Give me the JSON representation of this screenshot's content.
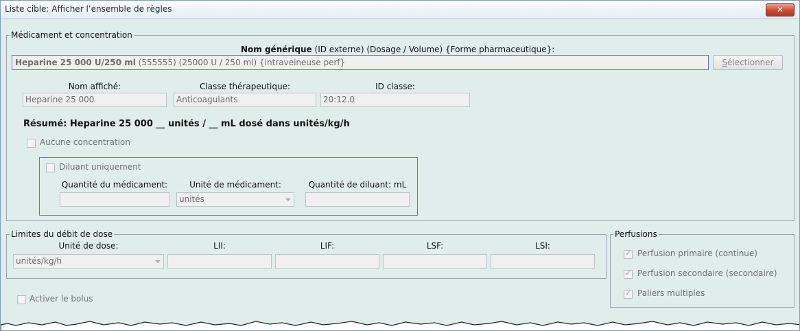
{
  "window": {
    "title": "Liste cible: Afficher l’ensemble de règles",
    "close_symbol": "✕"
  },
  "med": {
    "legend": "Médicament et concentration",
    "header_bold": "Nom générique",
    "header_rest": "(ID externe) (Dosage / Volume) {Forme pharmaceutique}:",
    "name_bold": "Heparine 25 000 U/250 ml",
    "name_rest": "(555555) (25000 U / 250 ml) {intraveineuse perf}",
    "select_first": "S",
    "select_rest": "électionner",
    "display_name_label": "Nom affiché:",
    "display_name_value": "Heparine 25 000",
    "class_label": "Classe thérapeutique:",
    "class_value": "Anticoagulants",
    "class_id_label": "ID classe:",
    "class_id_value": "20:12.0",
    "summary": "Résumé: Heparine 25 000 __ unités / __ mL dosé dans unités/kg/h",
    "no_concentration": "Aucune concentration",
    "diluent_only": "Diluant uniquement",
    "drug_qty_label": "Quantité du médicament:",
    "drug_qty_value": "",
    "drug_unit_label": "Unité de médicament:",
    "drug_unit_value": "unités",
    "diluent_qty_label": "Quantité de diluant: mL",
    "diluent_qty_value": ""
  },
  "limits": {
    "legend": "Limites du débit de dose",
    "dose_unit_label": "Unité de dose:",
    "dose_unit_value": "unités/kg/h",
    "lii_label": "LII:",
    "lif_label": "LIF:",
    "lsf_label": "LSF:",
    "lsi_label": "LSI:"
  },
  "infusions": {
    "legend": "Perfusions",
    "items": [
      {
        "label": "Perfusion primaire (continue)",
        "checked": true
      },
      {
        "label": "Perfusion secondaire (secondaire)",
        "checked": true
      },
      {
        "label": "Paliers multiples",
        "checked": true
      }
    ]
  },
  "bolus_label": "Activer le bolus",
  "colors": {
    "background": "#dfeeea",
    "close_button": "#c94a33",
    "group_border": "#9aa4b4"
  }
}
